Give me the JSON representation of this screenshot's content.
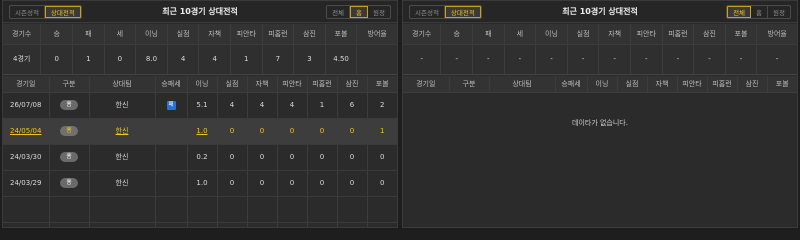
{
  "left": {
    "tabs_left": [
      "시즌성적",
      "상대전적"
    ],
    "tabs_left_active": 1,
    "title": "최근 10경기 상대전적",
    "tabs_right": [
      "전체",
      "홈",
      "원정"
    ],
    "tabs_right_active": 1,
    "summary": {
      "headers": [
        "경기수",
        "승",
        "패",
        "세",
        "이닝",
        "실점",
        "자책",
        "피안타",
        "피홈런",
        "삼진",
        "포볼",
        "방어율"
      ],
      "values": [
        "4경기",
        "0",
        "1",
        "0",
        "8.0",
        "4",
        "4",
        "1",
        "7",
        "3",
        "4.50"
      ]
    },
    "detail": {
      "headers": [
        "경기일",
        "구분",
        "상대팀",
        "승패세",
        "이닝",
        "실점",
        "자책",
        "피안타",
        "피홈런",
        "삼진",
        "포볼"
      ],
      "rows": [
        {
          "date": "26/07/08",
          "type": "홈",
          "team": "한신",
          "result": "패",
          "ip": "5.1",
          "r": "4",
          "er": "4",
          "h": "4",
          "hr": "1",
          "so": "6",
          "bb": "2"
        },
        {
          "date": "24/05/04",
          "type": "홈",
          "team": "한신",
          "result": "",
          "ip": "1.0",
          "r": "0",
          "er": "0",
          "h": "0",
          "hr": "0",
          "so": "0",
          "bb": "1"
        },
        {
          "date": "24/03/30",
          "type": "홈",
          "team": "한신",
          "result": "",
          "ip": "0.2",
          "r": "0",
          "er": "0",
          "h": "0",
          "hr": "0",
          "so": "0",
          "bb": "0"
        },
        {
          "date": "24/03/29",
          "type": "홈",
          "team": "한신",
          "result": "",
          "ip": "1.0",
          "r": "0",
          "er": "0",
          "h": "0",
          "hr": "0",
          "so": "0",
          "bb": "0"
        }
      ]
    }
  },
  "right": {
    "tabs_left": [
      "시즌성적",
      "상대전적"
    ],
    "tabs_left_active": 1,
    "title": "최근 10경기 상대전적",
    "tabs_right": [
      "전체",
      "홈",
      "원정"
    ],
    "tabs_right_active": 0,
    "summary": {
      "headers": [
        "경기수",
        "승",
        "패",
        "세",
        "이닝",
        "실점",
        "자책",
        "피안타",
        "피홈런",
        "삼진",
        "포볼",
        "방어율"
      ],
      "values": [
        "-",
        "-",
        "-",
        "-",
        "-",
        "-",
        "-",
        "-",
        "-",
        "-",
        "-",
        "-"
      ]
    },
    "detail": {
      "headers": [
        "경기일",
        "구분",
        "상대팀",
        "승패세",
        "이닝",
        "실점",
        "자책",
        "피안타",
        "피홈런",
        "삼진",
        "포볼"
      ]
    },
    "no_data": "데이타가 없습니다."
  },
  "colors": {
    "accent": "#f0c419",
    "loss_badge": "#2f6fd3"
  }
}
